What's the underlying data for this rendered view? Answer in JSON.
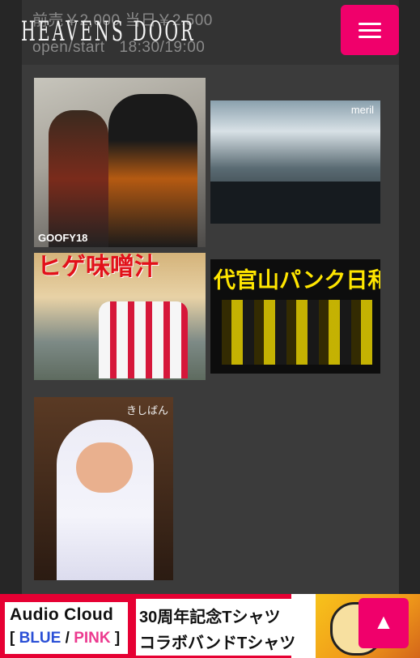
{
  "header": {
    "price_text": "前売￥2,000 当日￥2,500",
    "open_label": "open/start",
    "time_text": "18:30/19:00",
    "logo_text": "HEAVENS DOOR",
    "menu_icon": "hamburger-icon",
    "accent_color": "#f0006b"
  },
  "performers": [
    {
      "caption": "GOOFY18"
    },
    {
      "caption": "meril"
    },
    {
      "caption": "ヒゲ味噌汁"
    },
    {
      "caption": "代官山パンク日和"
    },
    {
      "caption": "きしばん"
    }
  ],
  "banner": {
    "left_title": "Audio Cloud",
    "left_bracket_open": "[",
    "left_blue": "BLUE",
    "left_slash": "/",
    "left_pink": "PINK",
    "left_bracket_close": "]",
    "mid_line1": "30周年記念Tシャツ",
    "mid_line2": "コラボバンドTシャツ"
  },
  "back_to_top": {
    "icon": "up-arrow-icon",
    "glyph": "▲"
  }
}
